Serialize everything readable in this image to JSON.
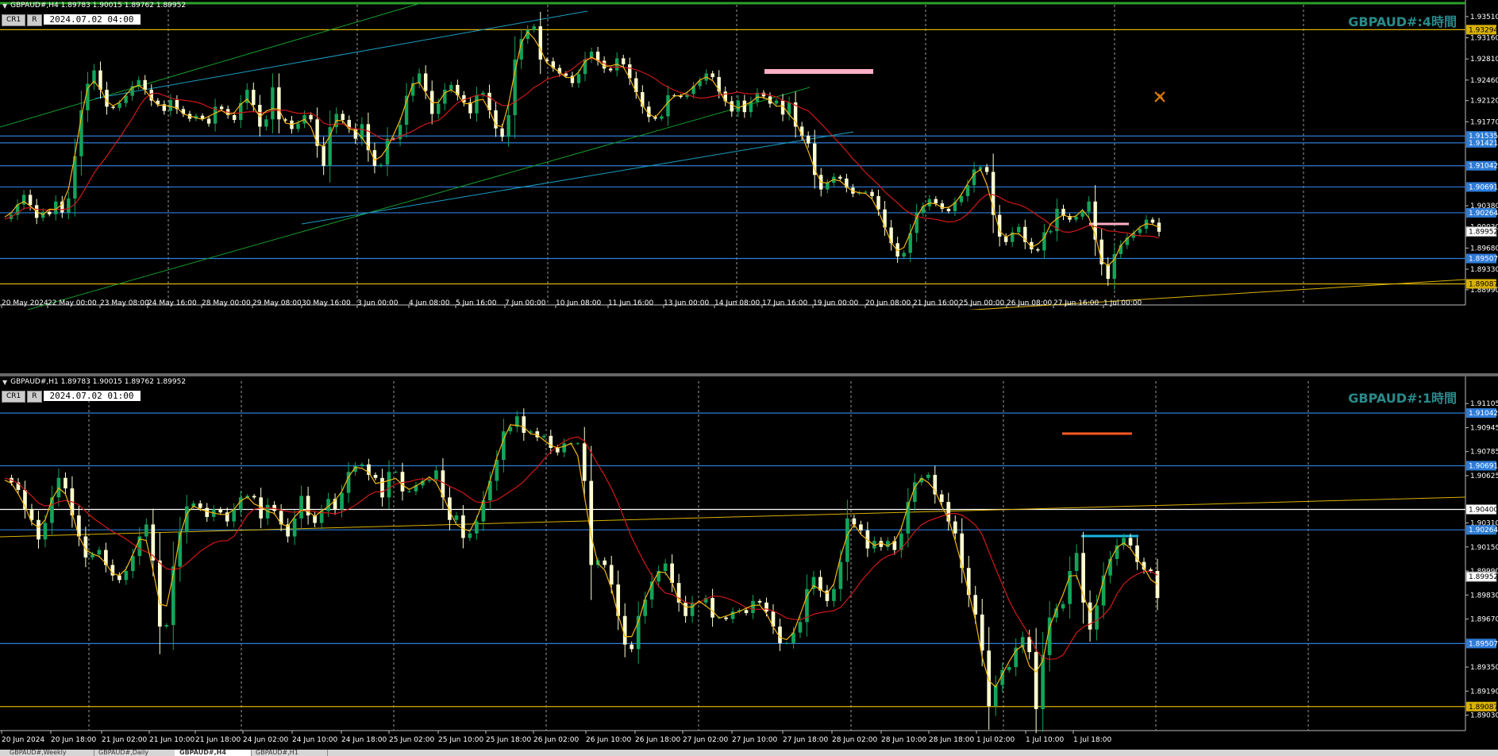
{
  "colors": {
    "bg": "#000000",
    "grid": "#9a9a9a",
    "bull": "#13a35a",
    "bear": "#ffffd0",
    "ma": "#d01818",
    "zigzag": "#f3b510",
    "hline": "#2e7bd6",
    "gold": "#d9b200",
    "cyan": "#19b5e0",
    "pink": "#ffb0c4",
    "orange": "#ff5a22",
    "green_trend": "#169c2a",
    "cyan_trend": "#1d9ec2"
  },
  "panels": [
    {
      "symbol_info": "GBPAUD#,H4  1.89783 1.90015 1.89762 1.89952",
      "btn1": "CR1",
      "btn2": "R",
      "time_label": "2024.07.02 04:00",
      "watermark": "GBPAUD#:4時間",
      "icon": "pencil-ruler-icon"
    },
    {
      "symbol_info": "GBPAUD#,H1  1.89783 1.90015 1.89762 1.89952",
      "btn1": "CR1",
      "btn2": "R",
      "time_label": "2024.07.02 01:00",
      "watermark": "GBPAUD#:1時間"
    }
  ],
  "tabs": [
    "GBPAUD#,Weekly",
    "GBPAUD#,Daily",
    "GBPAUD#,H4",
    "GBPAUD#,H1"
  ],
  "active_tab": 2,
  "chart_data": [
    {
      "type": "candlestick",
      "timeframe": "H4",
      "x_ticks": [
        "20 May 2024",
        "22 May 00:00",
        "23 May 08:00",
        "24 May 16:00",
        "28 May 00:00",
        "29 May 08:00",
        "30 May 16:00",
        "3 Jun 00:00",
        "4 Jun 08:00",
        "5 Jun 16:00",
        "7 Jun 00:00",
        "10 Jun 08:00",
        "11 Jun 16:00",
        "13 Jun 00:00",
        "14 Jun 08:00",
        "17 Jun 16:00",
        "19 Jun 00:00",
        "20 Jun 08:00",
        "21 Jun 16:00",
        "25 Jun 00:00",
        "26 Jun 08:00",
        "27 Jun 16:00",
        "1 Jul 00:00"
      ],
      "y_ticks": [
        1.9351,
        1.9316,
        1.9281,
        1.9246,
        1.9212,
        1.9177,
        1.9038,
        1.9003,
        1.8968,
        1.8933,
        1.8899
      ],
      "ylim": [
        1.8887,
        1.9368
      ],
      "level_labels": [
        {
          "value": 1.93294,
          "color": "gold"
        },
        {
          "value": 1.91535,
          "color": "hline"
        },
        {
          "value": 1.91421,
          "color": "hline"
        },
        {
          "value": 1.91042,
          "color": "hline"
        },
        {
          "value": 1.90691,
          "color": "hline"
        },
        {
          "value": 1.90264,
          "color": "hline"
        },
        {
          "value": 1.89952,
          "color": "current"
        },
        {
          "value": 1.89507,
          "color": "hline"
        },
        {
          "value": 1.89087,
          "color": "gold"
        }
      ],
      "close_series": [
        1.9016,
        1.9023,
        1.904,
        1.9056,
        1.9039,
        1.9018,
        1.9028,
        1.9024,
        1.9045,
        1.9027,
        1.905,
        1.912,
        1.9196,
        1.924,
        1.9262,
        1.923,
        1.9202,
        1.92,
        1.9208,
        1.922,
        1.9236,
        1.9246,
        1.923,
        1.9212,
        1.9206,
        1.9195,
        1.9213,
        1.9198,
        1.919,
        1.9182,
        1.9187,
        1.9182,
        1.9174,
        1.9202,
        1.9198,
        1.9188,
        1.918,
        1.9208,
        1.923,
        1.9205,
        1.9169,
        1.9181,
        1.9234,
        1.9181,
        1.9179,
        1.9165,
        1.9174,
        1.9188,
        1.9181,
        1.9137,
        1.9104,
        1.9168,
        1.919,
        1.918,
        1.9166,
        1.9149,
        1.9173,
        1.913,
        1.9104,
        1.9106,
        1.9149,
        1.9148,
        1.9172,
        1.922,
        1.9241,
        1.9257,
        1.9228,
        1.919,
        1.9207,
        1.923,
        1.9238,
        1.9221,
        1.9209,
        1.9191,
        1.9221,
        1.9225,
        1.9196,
        1.9166,
        1.9152,
        1.9188,
        1.928,
        1.9314,
        1.9329,
        1.9335,
        1.928,
        1.9277,
        1.9266,
        1.9257,
        1.9253,
        1.9241,
        1.9256,
        1.9281,
        1.9293,
        1.9278,
        1.9265,
        1.9262,
        1.9282,
        1.9272,
        1.9249,
        1.9226,
        1.9202,
        1.9185,
        1.9182,
        1.9186,
        1.9221,
        1.922,
        1.9218,
        1.9223,
        1.9236,
        1.9245,
        1.9257,
        1.9251,
        1.9227,
        1.9211,
        1.9194,
        1.9212,
        1.9193,
        1.921,
        1.9225,
        1.9219,
        1.9207,
        1.9212,
        1.9189,
        1.9209,
        1.9169,
        1.9154,
        1.9141,
        1.9089,
        1.9065,
        1.9076,
        1.9086,
        1.9083,
        1.9068,
        1.9058,
        1.906,
        1.9061,
        1.9054,
        1.9032,
        1.9002,
        1.8976,
        1.8954,
        1.896,
        1.8993,
        1.9026,
        1.9037,
        1.9049,
        1.9042,
        1.9033,
        1.9029,
        1.9044,
        1.9054,
        1.9072,
        1.9098,
        1.9102,
        1.9094,
        1.9023,
        1.8987,
        1.8978,
        1.8994,
        1.9003,
        1.8978,
        1.8966,
        1.8964,
        1.8994,
        1.8996,
        1.9033,
        1.9021,
        1.9015,
        1.902,
        1.9028,
        1.9045,
        1.8982,
        1.8941,
        1.8917,
        1.8958,
        1.8973,
        1.8985,
        1.8993,
        1.9,
        1.9015,
        1.901,
        1.8995
      ]
    },
    {
      "type": "candlestick",
      "timeframe": "H1",
      "x_ticks": [
        "20 Jun 2024",
        "20 Jun 18:00",
        "21 Jun 02:00",
        "21 Jun 10:00",
        "21 Jun 18:00",
        "24 Jun 02:00",
        "24 Jun 10:00",
        "24 Jun 18:00",
        "25 Jun 02:00",
        "25 Jun 10:00",
        "25 Jun 18:00",
        "26 Jun 02:00",
        "26 Jun 10:00",
        "26 Jun 18:00",
        "27 Jun 02:00",
        "27 Jun 10:00",
        "27 Jun 18:00",
        "28 Jun 02:00",
        "28 Jun 10:00",
        "28 Jun 18:00",
        "1 Jul 02:00",
        "1 Jul 10:00",
        "1 Jul 18:00"
      ],
      "y_ticks": [
        1.91105,
        1.90945,
        1.90785,
        1.90625,
        1.9031,
        1.9015,
        1.8999,
        1.8983,
        1.8967,
        1.8935,
        1.8919,
        1.8903
      ],
      "ylim": [
        1.8898,
        1.9118
      ],
      "level_labels": [
        {
          "value": 1.91042,
          "color": "hline"
        },
        {
          "value": 1.90691,
          "color": "hline"
        },
        {
          "value": 1.904,
          "color": "white"
        },
        {
          "value": 1.90264,
          "color": "hline"
        },
        {
          "value": 1.89952,
          "color": "current"
        },
        {
          "value": 1.89507,
          "color": "hline"
        },
        {
          "value": 1.89087,
          "color": "gold"
        }
      ],
      "close_series": [
        1.9061,
        1.9058,
        1.9053,
        1.904,
        1.9033,
        1.902,
        1.9031,
        1.9048,
        1.9061,
        1.9054,
        1.9036,
        1.9022,
        1.9008,
        1.901,
        1.9013,
        1.9003,
        1.8996,
        1.8993,
        1.8999,
        1.9009,
        1.9022,
        1.903,
        1.9006,
        1.8962,
        1.8963,
        1.9002,
        1.9025,
        1.9042,
        1.9044,
        1.9041,
        1.9035,
        1.904,
        1.9038,
        1.9032,
        1.904,
        1.9048,
        1.9049,
        1.9048,
        1.9034,
        1.9043,
        1.9039,
        1.903,
        1.9022,
        1.9034,
        1.9049,
        1.9036,
        1.9031,
        1.9039,
        1.9047,
        1.904,
        1.9051,
        1.9065,
        1.9069,
        1.907,
        1.9063,
        1.9061,
        1.9048,
        1.9065,
        1.9065,
        1.9052,
        1.9052,
        1.9056,
        1.9059,
        1.906,
        1.9066,
        1.9048,
        1.9033,
        1.9036,
        1.9021,
        1.9024,
        1.9032,
        1.9046,
        1.9059,
        1.9073,
        1.9092,
        1.9095,
        1.9102,
        1.9091,
        1.9092,
        1.9088,
        1.9089,
        1.9081,
        1.9078,
        1.9084,
        1.9084,
        1.9084,
        1.9059,
        1.9003,
        1.9006,
        1.9003,
        1.899,
        1.8969,
        1.895,
        1.8947,
        1.8969,
        1.898,
        1.8992,
        1.8999,
        1.9004,
        1.8991,
        1.8978,
        1.8969,
        1.8978,
        1.8978,
        1.8981,
        1.8968,
        1.8968,
        1.8967,
        1.8972,
        1.8973,
        1.8971,
        1.8979,
        1.8978,
        1.8972,
        1.8962,
        1.8951,
        1.8951,
        1.8958,
        1.8965,
        1.8987,
        1.8995,
        1.8986,
        1.8979,
        1.8987,
        1.9005,
        1.9034,
        1.903,
        1.9026,
        1.9014,
        1.9019,
        1.9015,
        1.9019,
        1.9013,
        1.9024,
        1.9045,
        1.9058,
        1.9061,
        1.9063,
        1.905,
        1.9045,
        1.9032,
        1.9024,
        1.9001,
        1.8983,
        1.897,
        1.8946,
        1.8909,
        1.8923,
        1.8933,
        1.8935,
        1.8948,
        1.8955,
        1.8945,
        1.8907,
        1.8943,
        1.8968,
        1.8974,
        1.8977,
        1.8999,
        1.9011,
        1.8978,
        1.896,
        1.8976,
        1.8996,
        1.9007,
        1.9016,
        1.9021,
        1.9016,
        1.9005,
        1.9,
        1.8999,
        1.8981
      ]
    }
  ]
}
